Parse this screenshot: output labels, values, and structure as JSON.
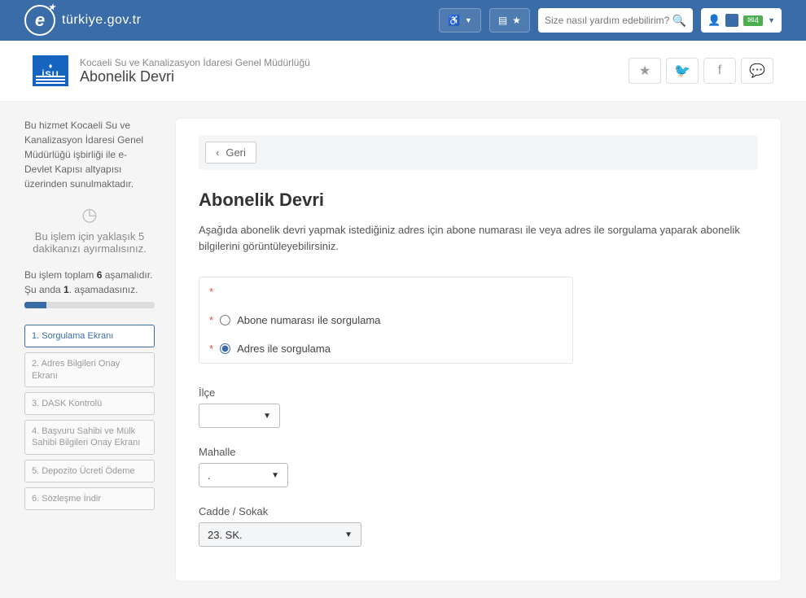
{
  "header": {
    "logo_text": "türkiye.gov.tr",
    "search_placeholder": "Size nasıl yardım edebilirim?",
    "badge": "4"
  },
  "title": {
    "isu_label": "İSU",
    "organization": "Kocaeli Su ve Kanalizasyon İdaresi Genel Müdürlüğü",
    "service": "Abonelik Devri"
  },
  "sidebar": {
    "cooperation_text": "Bu hizmet Kocaeli Su ve Kanalizasyon İdaresi Genel Müdürlüğü işbirliği ile e-Devlet Kapısı altyapısı üzerinden sunulmaktadır.",
    "time_prefix": "Bu işlem için yaklaşık ",
    "time_value": "5",
    "time_suffix": " dakikanızı ayırmalısınız.",
    "progress_prefix": "Bu işlem toplam ",
    "progress_total": "6",
    "progress_mid": " aşamalıdır. Şu anda ",
    "progress_current": "1",
    "progress_suffix": ". aşamadasınız.",
    "steps": [
      "1. Sorgulama Ekranı",
      "2. Adres Bilgileri Onay Ekranı",
      "3. DASK Kontrolü",
      "4. Başvuru Sahibi ve Mülk Sahibi Bilgileri Onay Ekranı",
      "5. Depozito Ücreti Ödeme",
      "6. Sözleşme İndir"
    ]
  },
  "content": {
    "back_label": "Geri",
    "heading": "Abonelik Devri",
    "intro": "Aşağıda abonelik devri yapmak istediğiniz adres için abone numarası ile veya adres ile sorgulama yaparak abonelik bilgilerini görüntüleyebilirsiniz.",
    "radio1": "Abone numarası ile sorgulama",
    "radio2": "Adres ile sorgulama",
    "field_ilce": "İlçe",
    "field_mahalle": "Mahalle",
    "field_cadde": "Cadde / Sokak",
    "value_ilce": "",
    "value_mahalle": ".",
    "value_cadde": "23. SK.",
    "asterisk": "*"
  }
}
